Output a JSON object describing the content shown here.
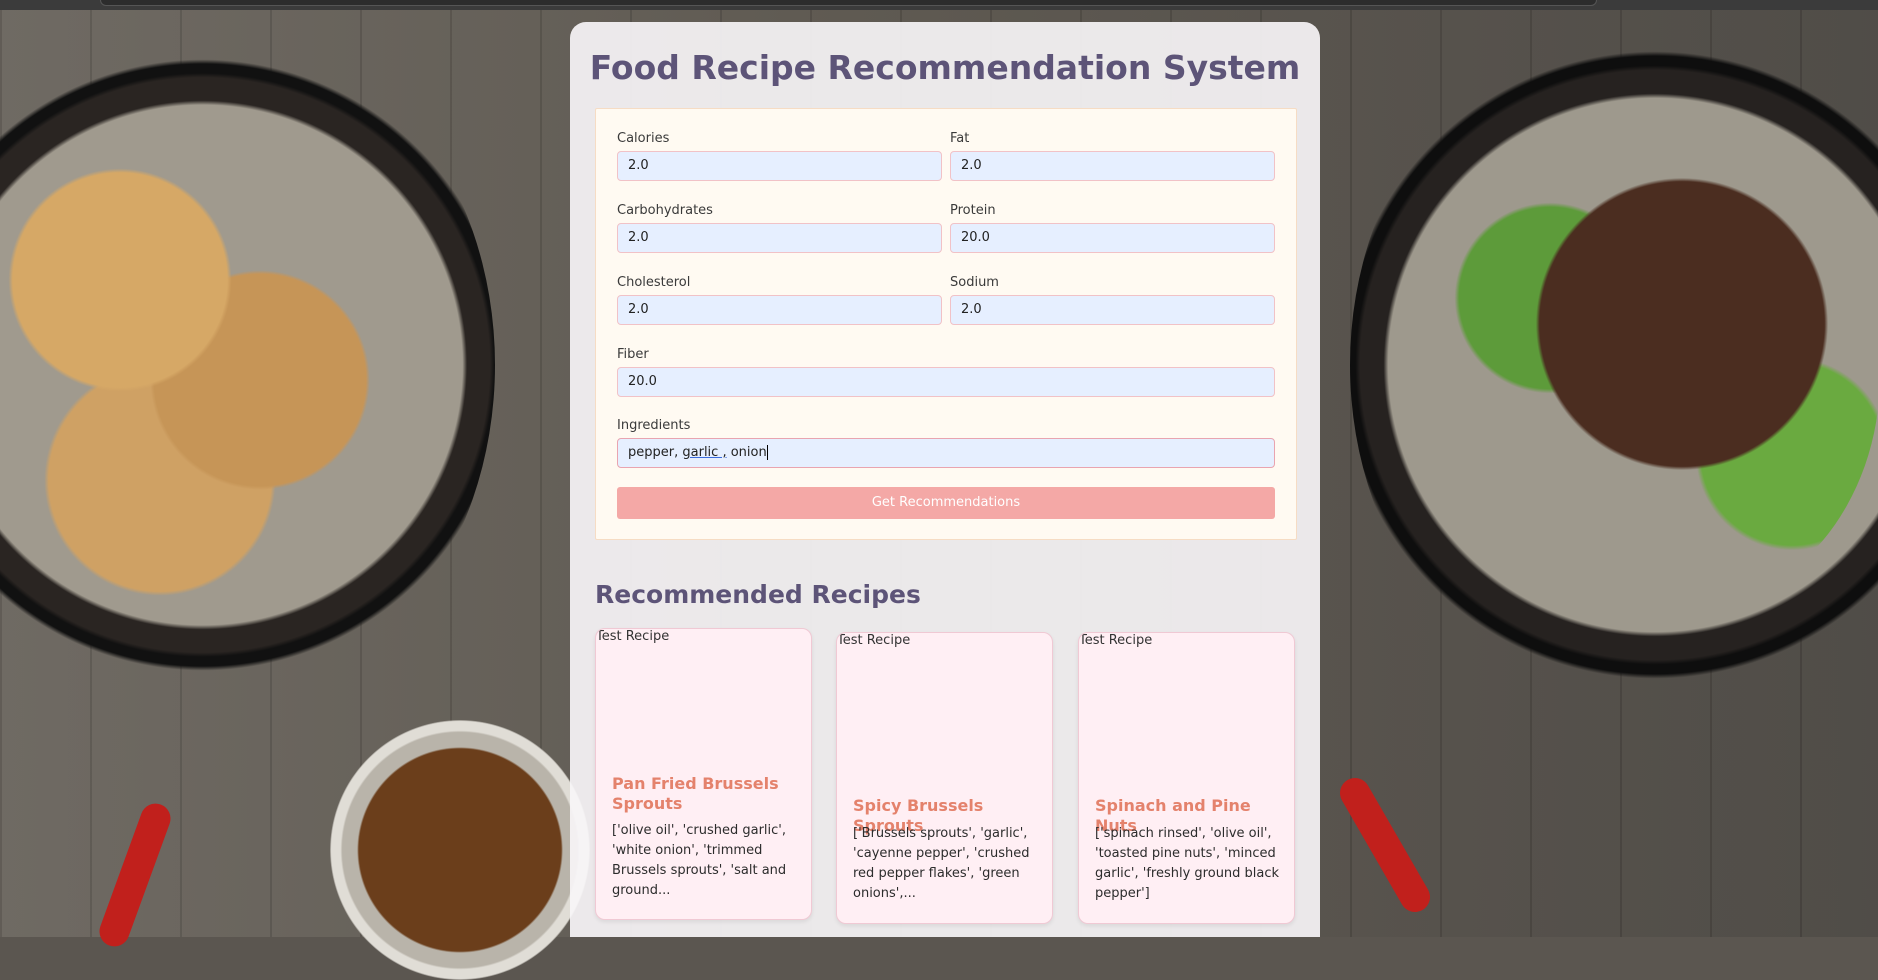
{
  "page": {
    "title": "Food Recipe Recommendation System"
  },
  "form": {
    "calories_label": "Calories",
    "calories_value": "2.0",
    "fat_label": "Fat",
    "fat_value": "2.0",
    "carbs_label": "Carbohydrates",
    "carbs_value": "2.0",
    "protein_label": "Protein",
    "protein_value": "20.0",
    "cholesterol_label": "Cholesterol",
    "cholesterol_value": "2.0",
    "sodium_label": "Sodium",
    "sodium_value": "2.0",
    "fiber_label": "Fiber",
    "fiber_value": "20.0",
    "ingredients_label": "Ingredients",
    "ingredients_value_part1": "pepper, ",
    "ingredients_value_part2": "garlic ,",
    "ingredients_value_part3": " onion",
    "submit_label": "Get Recommendations"
  },
  "results": {
    "heading": "Recommended Recipes",
    "recipes": [
      {
        "image_alt": "Test Recipe",
        "title": "Pan Fried Brussels Sprouts",
        "ingredients": "['olive oil', 'crushed garlic', 'white onion', 'trimmed Brussels sprouts', 'salt and ground..."
      },
      {
        "image_alt": "Test Recipe",
        "title": "Spicy Brussels Sprouts",
        "ingredients": "['Brussels sprouts', 'garlic', 'cayenne pepper', 'crushed red pepper flakes', 'green onions',..."
      },
      {
        "image_alt": "Test Recipe",
        "title": "Spinach and Pine Nuts",
        "ingredients": "['spinach rinsed', 'olive oil', 'toasted pine nuts', 'minced garlic', 'freshly ground black pepper']"
      }
    ]
  }
}
